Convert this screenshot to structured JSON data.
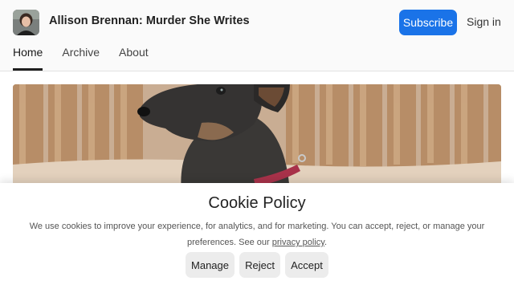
{
  "header": {
    "publication_title": "Allison Brennan: Murder She Writes",
    "subscribe_label": "Subscribe",
    "signin_label": "Sign in",
    "accent_color": "#1a73e8"
  },
  "nav": {
    "tabs": [
      {
        "label": "Home",
        "active": true
      },
      {
        "label": "Archive",
        "active": false
      },
      {
        "label": "About",
        "active": false
      }
    ]
  },
  "hero": {
    "icon": "dog-photo"
  },
  "cookie_banner": {
    "title": "Cookie Policy",
    "text_before_link": "We use cookies to improve your experience, for analytics, and for marketing. You can accept, reject, or manage your preferences. See our ",
    "link_text": "privacy policy",
    "text_after_link": ".",
    "buttons": {
      "manage": "Manage",
      "reject": "Reject",
      "accept": "Accept"
    }
  }
}
